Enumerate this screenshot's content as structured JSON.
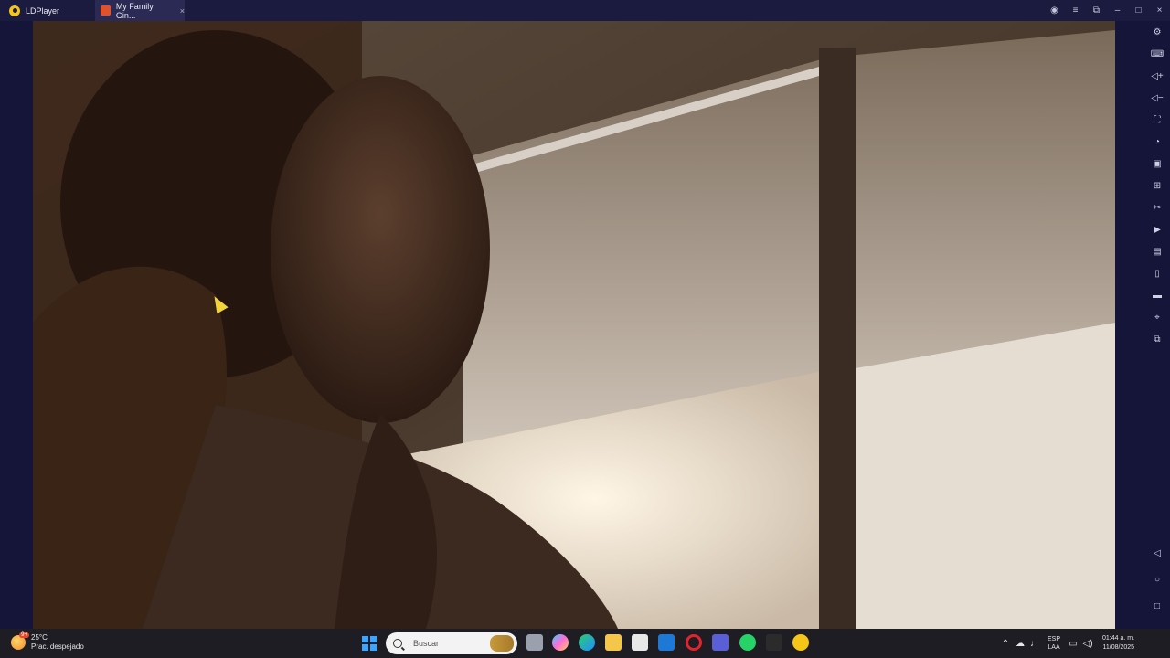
{
  "titlebar": {
    "app_name": "LDPlayer",
    "active_tab": "My Family Gin...",
    "close_glyph": "×"
  },
  "window_controls": [
    "profile-icon",
    "menu-icon",
    "restore-small-icon",
    "minimize-icon",
    "maximize-icon",
    "close-icon"
  ],
  "sidebar": {
    "icons": [
      "settings-icon",
      "keyboard-icon",
      "volume-up-icon",
      "volume-down-icon",
      "screenshot-icon",
      "mouse-icon",
      "record-icon",
      "robot-icon",
      "scissors-icon",
      "video-icon",
      "sync-icon",
      "apk-icon",
      "folder-icon",
      "location-icon",
      "multi-instance-icon"
    ],
    "nav": [
      "back-icon",
      "home-icon",
      "recents-icon"
    ]
  },
  "taskbar": {
    "weather": {
      "temp": "25°C",
      "condition": "Prac. despejado",
      "badge": "9+"
    },
    "search_placeholder": "Buscar",
    "apps": [
      "task-view-icon",
      "copilot-icon",
      "edge-icon",
      "file-explorer-icon",
      "store-icon",
      "outlook-icon",
      "opera-icon",
      "teams-icon",
      "whatsapp-icon",
      "app-icon",
      "ldplayer-icon"
    ],
    "lang_top": "ESP",
    "lang_bottom": "LAA",
    "time": "01:44 a. m.",
    "date": "11/08/2025"
  },
  "colors": {
    "accent": "#3aa6ff",
    "ld_yellow": "#f5c518",
    "tab_bg": "#2a2a55"
  }
}
